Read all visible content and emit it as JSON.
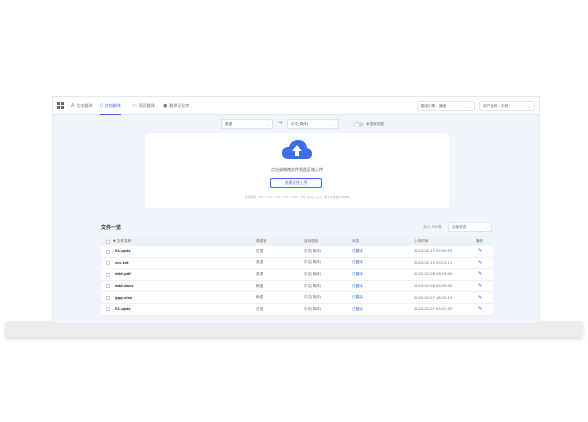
{
  "nav": {
    "tabs": [
      {
        "label": "文本翻译",
        "icon": "text-icon"
      },
      {
        "label": "文档翻译",
        "icon": "document-icon",
        "active": true
      },
      {
        "label": "网页翻译",
        "icon": "monitor-icon"
      },
      {
        "label": "翻译记忆库",
        "icon": "user-icon"
      }
    ],
    "engine_select": "翻译引擎：通用",
    "user_select": "用户名称：示例"
  },
  "translate": {
    "source_lang": "英语",
    "target_lang": "中文(简体)",
    "toggle_label": "术语库匹配",
    "toggle_on": false
  },
  "upload": {
    "prompt": "点击或拖拽文件到此区域上传",
    "button": "选择文件上传",
    "hint": "支持格式：txt、docx、xlsx、doc、pptx、pdf、jpeg、png，单个文件最大20MB"
  },
  "file_list": {
    "title": "文件一览",
    "count_label": "总计 300条",
    "sort_label": "全部状态",
    "columns": [
      "▼ 文件名称",
      "源语言",
      "目标语言",
      "状态",
      "上传时间",
      "操作"
    ],
    "rows": [
      {
        "name": "01.pptx",
        "src": "日语",
        "tgt": "中文(简体)",
        "status": "已翻译",
        "time": "2023-02-15 09:20:53"
      },
      {
        "name": "ccc.txt",
        "src": "英语",
        "tgt": "中文(简体)",
        "status": "已翻译",
        "time": "2023-02-15 09:12:13"
      },
      {
        "name": "ddd.pdf",
        "src": "英语",
        "tgt": "中文(简体)",
        "status": "已翻译",
        "time": "2023-02-08 18:24:00"
      },
      {
        "name": "ddd.docx",
        "src": "韩语",
        "tgt": "中文(简体)",
        "status": "已翻译",
        "time": "2023-02-08 09:25:42"
      },
      {
        "name": "ggg.xlsx",
        "src": "韩语",
        "tgt": "中文(简体)",
        "status": "已翻译",
        "time": "2023-02-07 18:20:13"
      },
      {
        "name": "01.pptx",
        "src": "日语",
        "tgt": "中文(简体)",
        "status": "已翻译",
        "time": "2023-02-07 09:41:52"
      }
    ]
  },
  "colors": {
    "accent": "#3d6ee8",
    "background": "#f1f4fa"
  }
}
